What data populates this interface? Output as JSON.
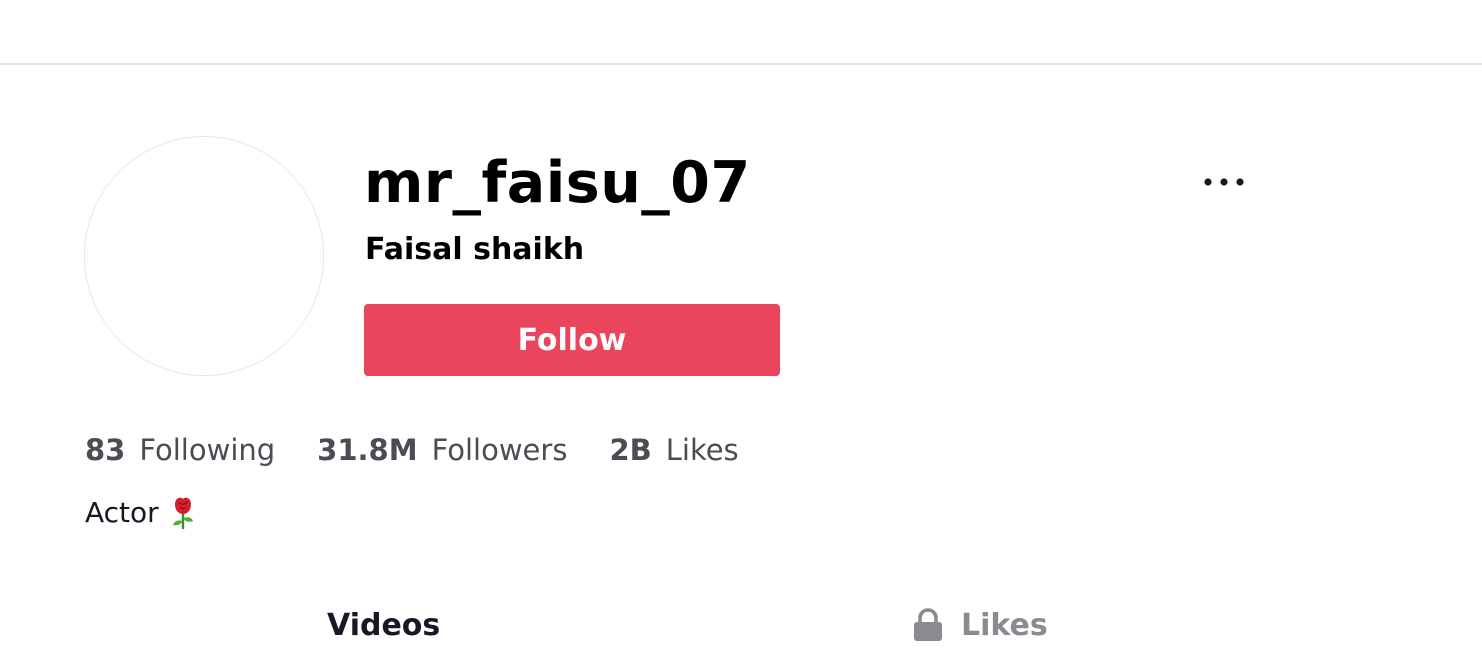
{
  "profile": {
    "username": "mr_faisu_07",
    "nickname": "Faisal shaikh",
    "follow_label": "Follow",
    "bio": "Actor",
    "bio_emoji": "rose-icon"
  },
  "stats": [
    {
      "value": "83",
      "label": "Following"
    },
    {
      "value": "31.8M",
      "label": "Followers"
    },
    {
      "value": "2B",
      "label": "Likes"
    }
  ],
  "tabs": [
    {
      "label": "Videos",
      "icon": null,
      "active": true
    },
    {
      "label": "Likes",
      "icon": "lock-icon",
      "active": false
    }
  ],
  "colors": {
    "accent": "#ea455c",
    "text": "#161823",
    "muted": "#8a8b91"
  }
}
